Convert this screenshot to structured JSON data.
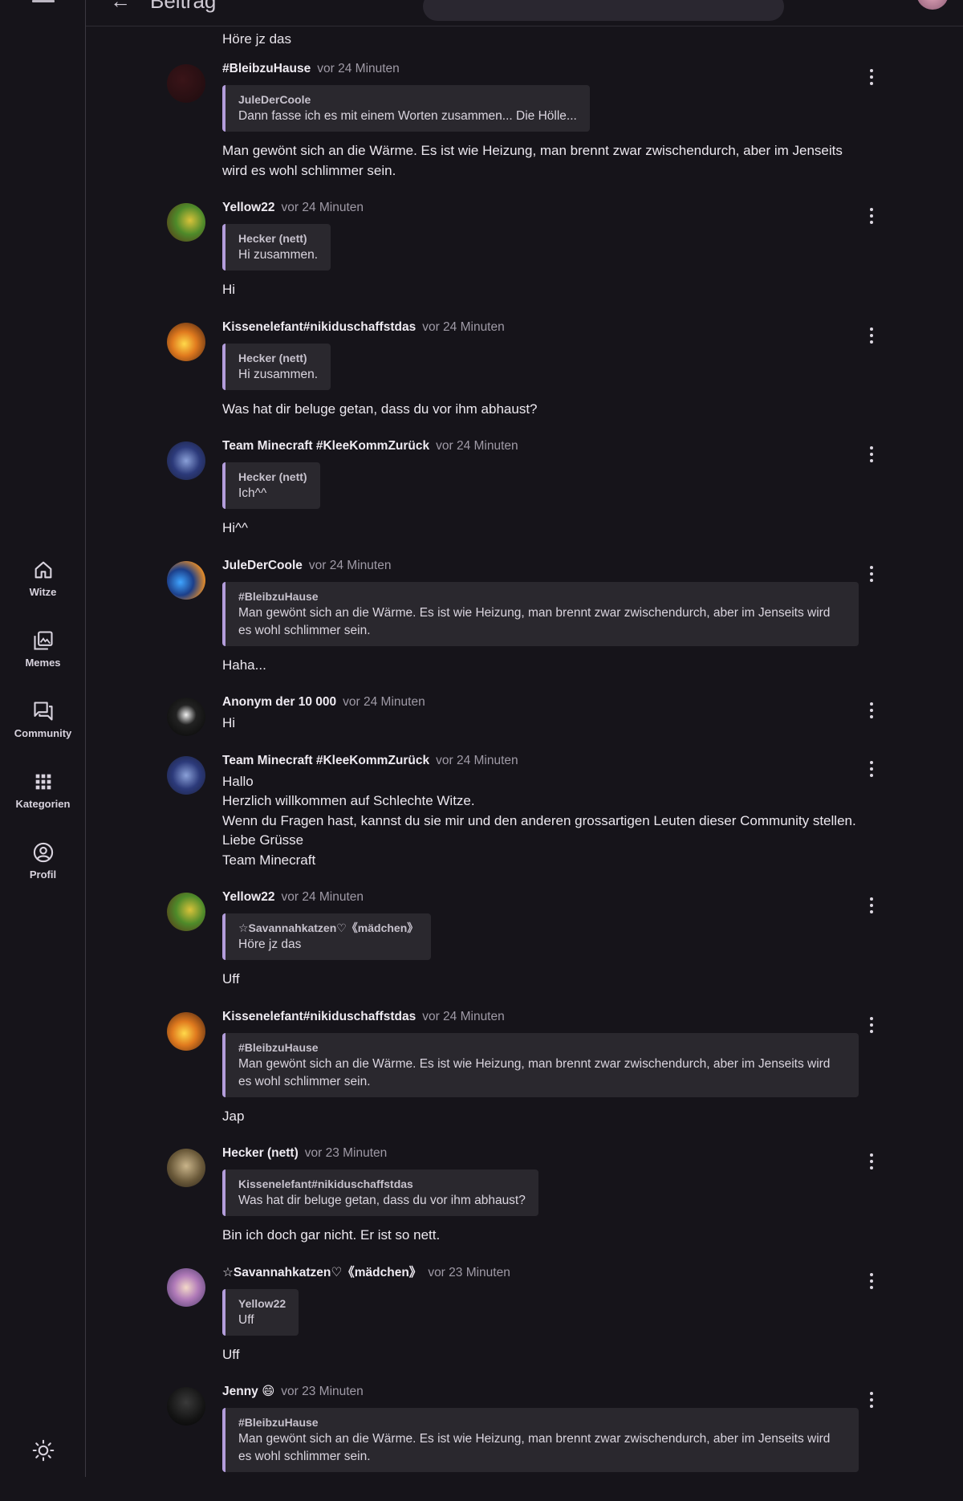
{
  "nav": {
    "items": [
      {
        "label": "Witze",
        "icon": "home-icon"
      },
      {
        "label": "Memes",
        "icon": "photo-library-icon"
      },
      {
        "label": "Community",
        "icon": "forum-icon"
      },
      {
        "label": "Kategorien",
        "icon": "apps-grid-icon"
      },
      {
        "label": "Profil",
        "icon": "account-circle-icon"
      }
    ],
    "theme_icon": "sun-icon",
    "menu_icon": "menu-icon"
  },
  "topbar": {
    "title": "Beitrag",
    "back_icon": "back-arrow-icon"
  },
  "previous_message_tail": "Höre jz das",
  "colors": {
    "background": "#16141a",
    "quote_bg": "#2a282e",
    "quote_accent": "#b39ddb",
    "time": "#9f9aa6"
  },
  "messages": [
    {
      "author": "#BleibzuHause",
      "time": "vor 24 Minuten",
      "quote": {
        "author": "JuleDerCoole",
        "text": "Dann fasse ich es mit einem Worten zusammen... Die Hölle..."
      },
      "lines": [
        "Man gewönt sich an die Wärme. Es ist wie Heizung, man brennt zwar zwischendurch, aber im Jenseits",
        "wird es wohl schlimmer sein."
      ]
    },
    {
      "author": "Yellow22",
      "time": "vor 24 Minuten",
      "quote": {
        "author": "Hecker (nett)",
        "text": "Hi zusammen."
      },
      "lines": [
        "Hi"
      ]
    },
    {
      "author": "Kissenelefant#nikiduschaffstdas",
      "time": "vor 24 Minuten",
      "quote": {
        "author": "Hecker (nett)",
        "text": "Hi zusammen."
      },
      "lines": [
        "Was hat dir beluge getan, dass du vor ihm abhaust?"
      ]
    },
    {
      "author": "Team Minecraft #KleeKommZurück",
      "time": "vor 24 Minuten",
      "quote": {
        "author": "Hecker (nett)",
        "text": "Ich^^"
      },
      "lines": [
        "Hi^^"
      ]
    },
    {
      "author": "JuleDerCoole",
      "time": "vor 24 Minuten",
      "quote": {
        "author": "#BleibzuHause",
        "text": "Man gewönt sich an die Wärme. Es ist wie Heizung, man brennt zwar zwischendurch, aber im Jenseits wird es wohl schlimmer sein."
      },
      "lines": [
        "Haha..."
      ]
    },
    {
      "author": "Anonym der 10 000",
      "time": "vor 24 Minuten",
      "quote": null,
      "lines": [
        "Hi"
      ]
    },
    {
      "author": "Team Minecraft #KleeKommZurück",
      "time": "vor 24 Minuten",
      "quote": null,
      "lines": [
        "Hallo",
        "Herzlich willkommen auf Schlechte Witze.",
        "Wenn du Fragen hast, kannst du sie mir und den anderen grossartigen Leuten dieser Community stellen.",
        "Liebe Grüsse",
        "Team Minecraft"
      ]
    },
    {
      "author": "Yellow22",
      "time": "vor 24 Minuten",
      "quote": {
        "author": "☆Savannahkatzen♡《mädchen》",
        "text": "Höre jz das"
      },
      "lines": [
        "Uff"
      ]
    },
    {
      "author": "Kissenelefant#nikiduschaffstdas",
      "time": "vor 24 Minuten",
      "quote": {
        "author": "#BleibzuHause",
        "text": "Man gewönt sich an die Wärme. Es ist wie Heizung, man brennt zwar zwischendurch, aber im Jenseits wird es wohl schlimmer sein."
      },
      "lines": [
        "Jap"
      ]
    },
    {
      "author": "Hecker (nett)",
      "time": "vor 23 Minuten",
      "quote": {
        "author": "Kissenelefant#nikiduschaffstdas",
        "text": "Was hat dir beluge getan, dass du vor ihm abhaust?"
      },
      "lines": [
        "Bin ich doch gar nicht. Er ist so nett."
      ]
    },
    {
      "author": "☆Savannahkatzen♡《mädchen》",
      "time": "vor 23 Minuten",
      "quote": {
        "author": "Yellow22",
        "text": "Uff"
      },
      "lines": [
        "Uff"
      ]
    },
    {
      "author": "Jenny 😄",
      "time": "vor 23 Minuten",
      "quote": {
        "author": "#BleibzuHause",
        "text": "Man gewönt sich an die Wärme. Es ist wie Heizung, man brennt zwar zwischendurch, aber im Jenseits wird es wohl schlimmer sein."
      },
      "lines": []
    }
  ]
}
